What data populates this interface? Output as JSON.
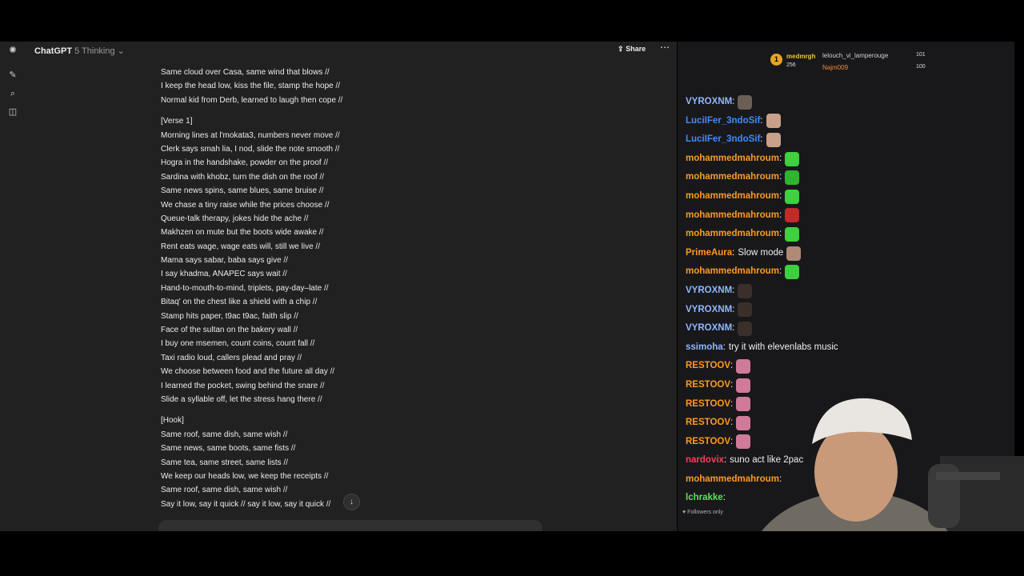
{
  "app": {
    "name": "ChatGPT",
    "model": "5 Thinking",
    "share_label": "Share"
  },
  "lyrics": [
    "Same cloud over Casa, same wind that blows //",
    "I keep the head low, kiss the file, stamp the hope //",
    "Normal kid from Derb, learned to laugh then cope //",
    "",
    "[Verse 1]",
    "Morning lines at l'mokata3, numbers never move //",
    "Clerk says smah lia, I nod, slide the note smooth //",
    "Hogra in the handshake, powder on the proof //",
    "Sardina with khobz, turn the dish on the roof //",
    "Same news spins, same blues, same bruise //",
    "We chase a tiny raise while the prices choose //",
    "Queue-talk therapy, jokes hide the ache //",
    "Makhzen on mute but the boots wide awake //",
    "Rent eats wage, wage eats will, still we live //",
    "Mama says sabar, baba says give //",
    "I say khadma, ANAPEC says wait //",
    "Hand-to-mouth-to-mind, triplets, pay-day–late //",
    "Bitaq' on the chest like a shield with a chip //",
    "Stamp hits paper, t9ac t9ac, faith slip //",
    "Face of the sultan on the bakery wall //",
    "I buy one msemen, count coins, count fall //",
    "Taxi radio loud, callers plead and pray //",
    "We choose between food and the future all day //",
    "I learned the pocket, swing behind the snare //",
    "Slide a syllable off, let the stress hang there //",
    "",
    "[Hook]",
    "Same roof, same dish, same wish //",
    "Same news, same boots, same fists //",
    "Same tea, same street, same lists //",
    "We keep our heads low, we keep the receipts //",
    "Same roof, same dish, same wish //",
    "Say it low, say it quick // say it low, say it quick //"
  ],
  "leaderboard": {
    "first": {
      "name": "medmrgh",
      "count": "256"
    },
    "second": {
      "name": "lelouch_vi_lamperouge",
      "count": "101"
    },
    "third": {
      "name": "Najm009",
      "count": "100"
    }
  },
  "chat": {
    "messages": [
      {
        "user": "VYROXNM",
        "color": "#8fb8ff",
        "text": "",
        "emote": "#6b5f55"
      },
      {
        "user": "LuciIFer_3ndoSif",
        "color": "#3d8cff",
        "text": "",
        "emote": "#c9a08a"
      },
      {
        "user": "LuciIFer_3ndoSif",
        "color": "#3d8cff",
        "text": "",
        "emote": "#c9a08a"
      },
      {
        "user": "mohammedmahroum",
        "color": "#ff9a1f",
        "text": "",
        "emote": "#3fcf3f"
      },
      {
        "user": "mohammedmahroum",
        "color": "#ff9a1f",
        "text": "",
        "emote": "#2fb52f"
      },
      {
        "user": "mohammedmahroum",
        "color": "#ff9a1f",
        "text": "",
        "emote": "#3fcf3f"
      },
      {
        "user": "mohammedmahroum",
        "color": "#ff9a1f",
        "text": "",
        "emote": "#c22a2a"
      },
      {
        "user": "mohammedmahroum",
        "color": "#ff9a1f",
        "text": "",
        "emote": "#3fcf3f"
      },
      {
        "user": "PrimeAura",
        "color": "#ff9a1f",
        "text": "Slow mode",
        "emote": "#b08a74"
      },
      {
        "user": "mohammedmahroum",
        "color": "#ff9a1f",
        "text": "",
        "emote": "#3fcf3f"
      },
      {
        "user": "VYROXNM",
        "color": "#8fb8ff",
        "text": "",
        "emote": "#3a2f2a"
      },
      {
        "user": "VYROXNM",
        "color": "#8fb8ff",
        "text": "",
        "emote": "#3a2f2a"
      },
      {
        "user": "VYROXNM",
        "color": "#8fb8ff",
        "text": "",
        "emote": "#3a2f2a"
      },
      {
        "user": "ssimoha",
        "color": "#8fb8ff",
        "text": "try it with elevenlabs music",
        "emote": ""
      },
      {
        "user": "RESTOOV",
        "color": "#ff9a1f",
        "text": "",
        "emote": "#d07a9a"
      },
      {
        "user": "RESTOOV",
        "color": "#ff9a1f",
        "text": "",
        "emote": "#d07a9a"
      },
      {
        "user": "RESTOOV",
        "color": "#ff9a1f",
        "text": "",
        "emote": "#d07a9a"
      },
      {
        "user": "RESTOOV",
        "color": "#ff9a1f",
        "text": "",
        "emote": "#d07a9a"
      },
      {
        "user": "RESTOOV",
        "color": "#ff9a1f",
        "text": "",
        "emote": "#d07a9a"
      },
      {
        "user": "nardovix",
        "color": "#ff3b5c",
        "text": "suno act like 2pac",
        "emote": ""
      },
      {
        "user": "mohammedmahroum",
        "color": "#ff9a1f",
        "text": "",
        "emote": ""
      },
      {
        "user": "lchrakke",
        "color": "#5be35b",
        "text": "",
        "emote": ""
      }
    ],
    "followers_only": "Followers only"
  },
  "colors": {
    "gpt_bg": "#212121",
    "chat_bg": "#18181b",
    "accent_gold": "#e7a520"
  }
}
